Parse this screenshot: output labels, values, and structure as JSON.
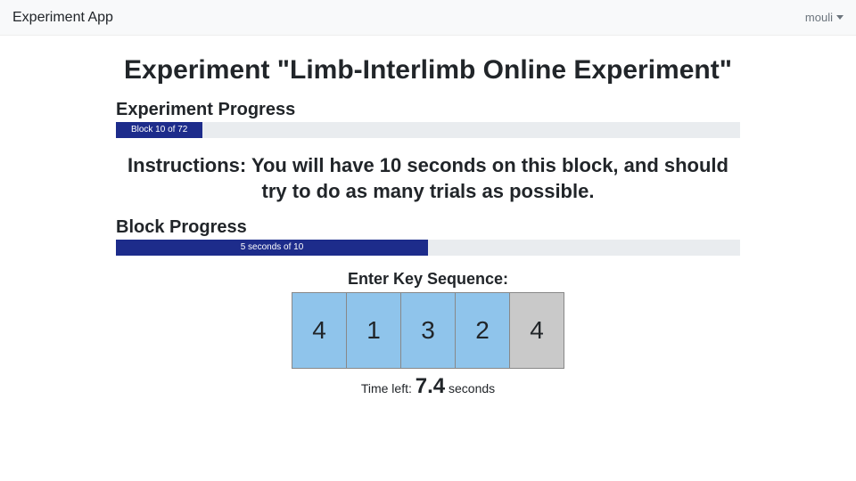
{
  "navbar": {
    "brand": "Experiment App",
    "user": "mouli"
  },
  "title": "Experiment \"Limb-Interlimb Online Experiment\"",
  "experiment_progress": {
    "label": "Experiment Progress",
    "text": "Block 10 of 72"
  },
  "instructions": "Instructions: You will have 10 seconds on this block, and should try to do as many trials as possible.",
  "block_progress": {
    "label": "Block Progress",
    "text": "5 seconds of 10"
  },
  "sequence": {
    "label": "Enter Key Sequence:",
    "cells": [
      "4",
      "1",
      "3",
      "2",
      "4"
    ],
    "active_count": 4
  },
  "time_left": {
    "prefix": "Time left: ",
    "value": "7.4",
    "suffix": " seconds"
  }
}
